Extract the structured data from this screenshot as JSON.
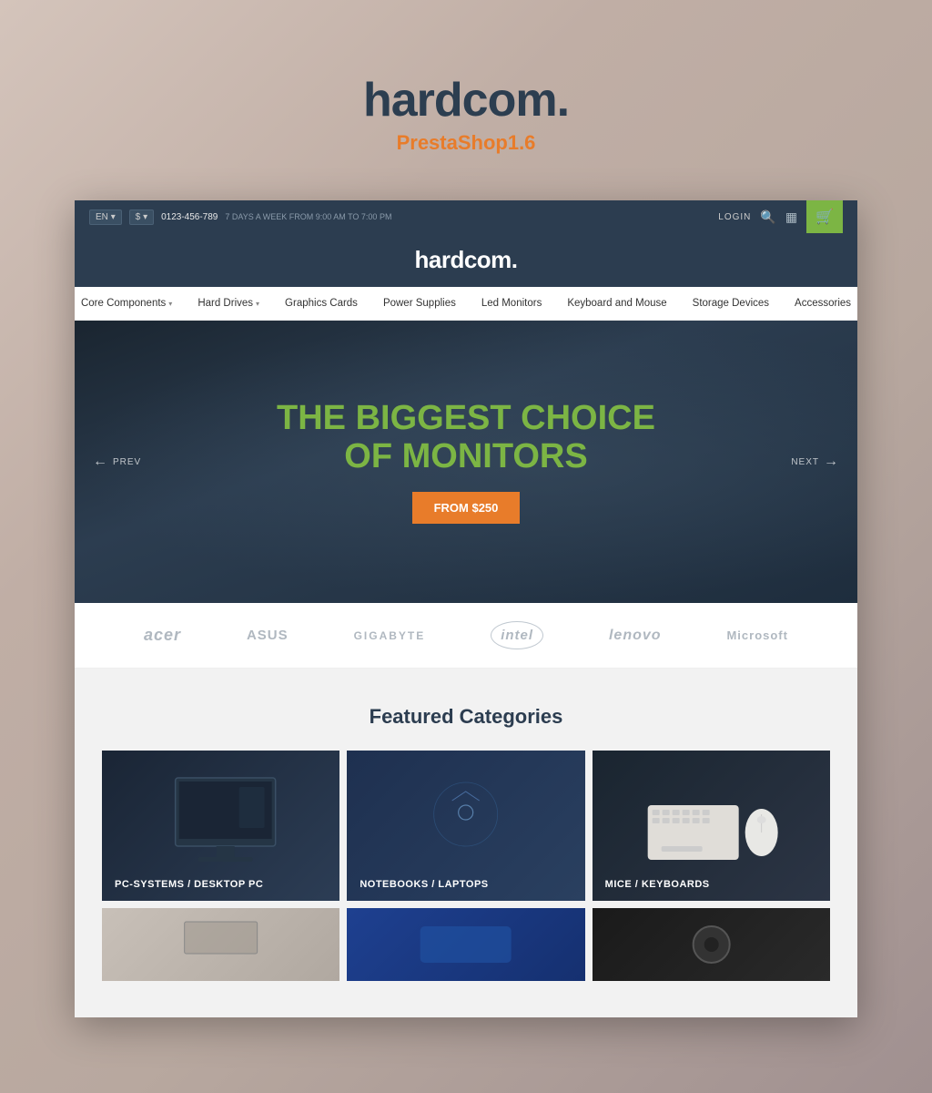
{
  "page": {
    "bg_color": "#c8b9b0"
  },
  "logo": {
    "main": "hardcom.",
    "sub": "PrestaShop1.6"
  },
  "topbar": {
    "lang": "EN",
    "lang_arrow": "▾",
    "currency": "$",
    "currency_arrow": "▾",
    "phone": "0123-456-789",
    "hours": "7 DAYS A WEEK FROM 9:00 AM TO 7:00 PM",
    "login": "LOGIN",
    "cart_icon": "🛒"
  },
  "header": {
    "logo": "hardcom."
  },
  "nav": {
    "items": [
      {
        "label": "Core Components",
        "has_dropdown": true
      },
      {
        "label": "Hard Drives",
        "has_dropdown": true
      },
      {
        "label": "Graphics Cards",
        "has_dropdown": false
      },
      {
        "label": "Power Supplies",
        "has_dropdown": false
      },
      {
        "label": "Led Monitors",
        "has_dropdown": false
      },
      {
        "label": "Keyboard and Mouse",
        "has_dropdown": false
      },
      {
        "label": "Storage Devices",
        "has_dropdown": false
      },
      {
        "label": "Accessories",
        "has_dropdown": false
      }
    ]
  },
  "hero": {
    "line1_prefix": "THE BIGGEST",
    "line1_highlight": " CHOICE",
    "line2_prefix": "OF ",
    "line2_highlight": "MONITORS",
    "cta": "FROM $250",
    "prev_label": "PREV",
    "next_label": "NEXT"
  },
  "brands": [
    {
      "name": "acer",
      "display": "acer",
      "style": "acer-logo"
    },
    {
      "name": "asus",
      "display": "ASUS",
      "style": "asus-logo"
    },
    {
      "name": "gigabyte",
      "display": "GIGABYTE",
      "style": "gigabyte-logo"
    },
    {
      "name": "intel",
      "display": "intel",
      "style": "intel-logo"
    },
    {
      "name": "lenovo",
      "display": "lenovo",
      "style": "lenovo-logo"
    },
    {
      "name": "microsoft",
      "display": "Microsoft",
      "style": "microsoft-logo"
    }
  ],
  "featured": {
    "title": "Featured Categories",
    "categories": [
      {
        "label": "PC-SYSTEMS / DESKTOP PC",
        "bg": "cat-bg-1"
      },
      {
        "label": "NOTEBOOKS / LAPTOPS",
        "bg": "cat-bg-2"
      },
      {
        "label": "MICE / KEYBOARDS",
        "bg": "cat-bg-3"
      }
    ],
    "categories_bottom": [
      {
        "label": "",
        "bg": "cat-thumb-1"
      },
      {
        "label": "",
        "bg": "cat-thumb-2"
      },
      {
        "label": "",
        "bg": "cat-thumb-3"
      }
    ]
  }
}
